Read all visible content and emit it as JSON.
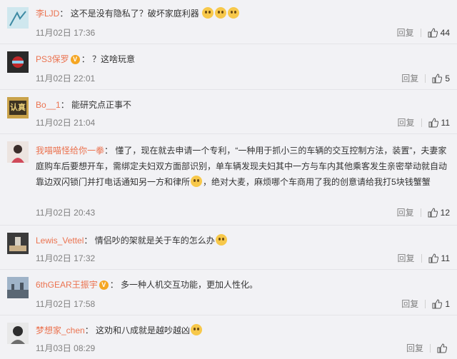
{
  "comments": [
    {
      "user": "李LJD",
      "vip": false,
      "text": "这不是没有隐私了？破坏家庭利器",
      "emoji_count": 3,
      "time": "11月02日 17:36",
      "reply": "回复",
      "likes": "44",
      "avatar_color": "#cfe7ee"
    },
    {
      "user": "PS3保罗",
      "vip": true,
      "text": "？这啥玩意",
      "emoji_count": 0,
      "time": "11月02日 22:01",
      "reply": "回复",
      "likes": "5",
      "avatar_color": "#2a2a2a"
    },
    {
      "user": "Bo__1",
      "vip": false,
      "text": "能研究点正事不",
      "emoji_count": 0,
      "time": "11月02日 21:04",
      "reply": "回复",
      "likes": "11",
      "avatar_color": "#c9a24a",
      "avatar_text": "认真"
    },
    {
      "user": "我喵喵怪给你一拳",
      "vip": false,
      "text": "懂了，现在就去申请一个专利，“一种用于抓小三的车辆的交互控制方法，装置”，夫妻家庭购车后要想开车，需绑定夫妇双方面部识别，单车辆发现夫妇其中一方与车内其他乘客发生亲密举动就自动靠边双闪锁门并打电话通知另一方和律所",
      "text2": "，绝对大麦，麻烦哪个车商用了我的创意请给我打5块钱蟹蟹",
      "emoji_count": 1,
      "time": "11月02日 20:43",
      "reply": "回复",
      "likes": "12",
      "avatar_color": "#d9c6c0"
    },
    {
      "user": "Lewis_Vettel",
      "vip": false,
      "text": "情侣吵的架就是关于车的怎么办",
      "emoji_count": 1,
      "time": "11月02日 17:32",
      "reply": "回复",
      "likes": "11",
      "avatar_color": "#3b3b3b"
    },
    {
      "user": "6thGEAR王振宇",
      "vip": true,
      "text": "多一种人机交互功能，更加人性化。",
      "emoji_count": 0,
      "time": "11月02日 17:58",
      "reply": "回复",
      "likes": "1",
      "avatar_color": "#7f93a8"
    },
    {
      "user": "梦想家_chen",
      "vip": false,
      "text": "这劝和八成就是越吵越凶",
      "emoji_count": 1,
      "time": "11月03日 08:29",
      "reply": "回复",
      "likes": "",
      "avatar_color": "#9b9b9b"
    }
  ],
  "colors": {
    "username": "#eb7350",
    "text": "#333333",
    "meta": "#808080",
    "bg": "#f2f2f5"
  },
  "icons": {
    "like": "thumbs-up-icon",
    "vip": "vip-badge-icon",
    "emoji": "emoji-icon"
  }
}
